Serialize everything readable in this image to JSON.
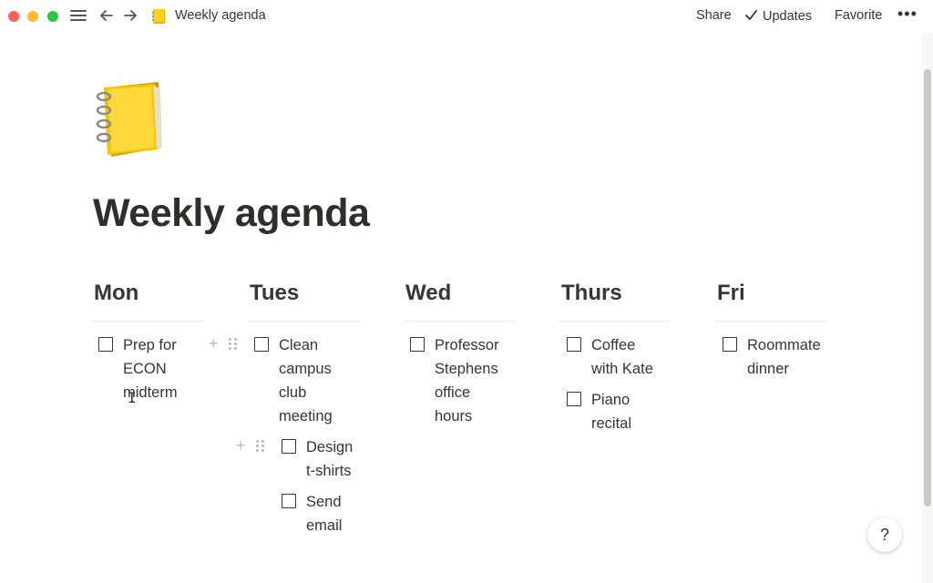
{
  "window": {
    "breadcrumb": "Weekly agenda",
    "icons": [
      "hamburger-icon",
      "back-arrow-icon",
      "forward-arrow-icon",
      "notebook-icon",
      "check-icon",
      "more-icon"
    ]
  },
  "toolbar": {
    "share_label": "Share",
    "updates_label": "Updates",
    "favorite_label": "Favorite",
    "more_label": "•••"
  },
  "page": {
    "title": "Weekly agenda",
    "emoji": "notebook"
  },
  "columns": [
    {
      "heading": "Mon",
      "todos": [
        {
          "lines": [
            "Prep for",
            "ECON",
            "midterm"
          ],
          "checked": false
        }
      ]
    },
    {
      "heading": "Tues",
      "todos": [
        {
          "lines": [
            "Clean",
            "campus",
            "club",
            "meeting"
          ],
          "checked": false
        },
        {
          "lines": [
            "Design",
            "t-shirts"
          ],
          "checked": false,
          "nested": true
        },
        {
          "lines": [
            "Send",
            "email"
          ],
          "checked": false,
          "nested": true
        }
      ]
    },
    {
      "heading": "Wed",
      "todos": [
        {
          "lines": [
            "Professor",
            "Stephens",
            "office",
            "hours"
          ],
          "checked": false
        }
      ]
    },
    {
      "heading": "Thurs",
      "todos": [
        {
          "lines": [
            "Coffee",
            "with Kate"
          ],
          "checked": false
        },
        {
          "lines": [
            "Piano",
            "recital"
          ],
          "checked": false
        }
      ]
    },
    {
      "heading": "Fri",
      "todos": [
        {
          "lines": [
            "Roommate",
            "dinner"
          ],
          "checked": false
        }
      ]
    }
  ],
  "help": {
    "label": "?"
  },
  "colors": {
    "text": "#37352f",
    "divider": "#e6e6e3",
    "red": "#ff5f57",
    "yellow": "#febc2e",
    "green": "#28c840"
  }
}
